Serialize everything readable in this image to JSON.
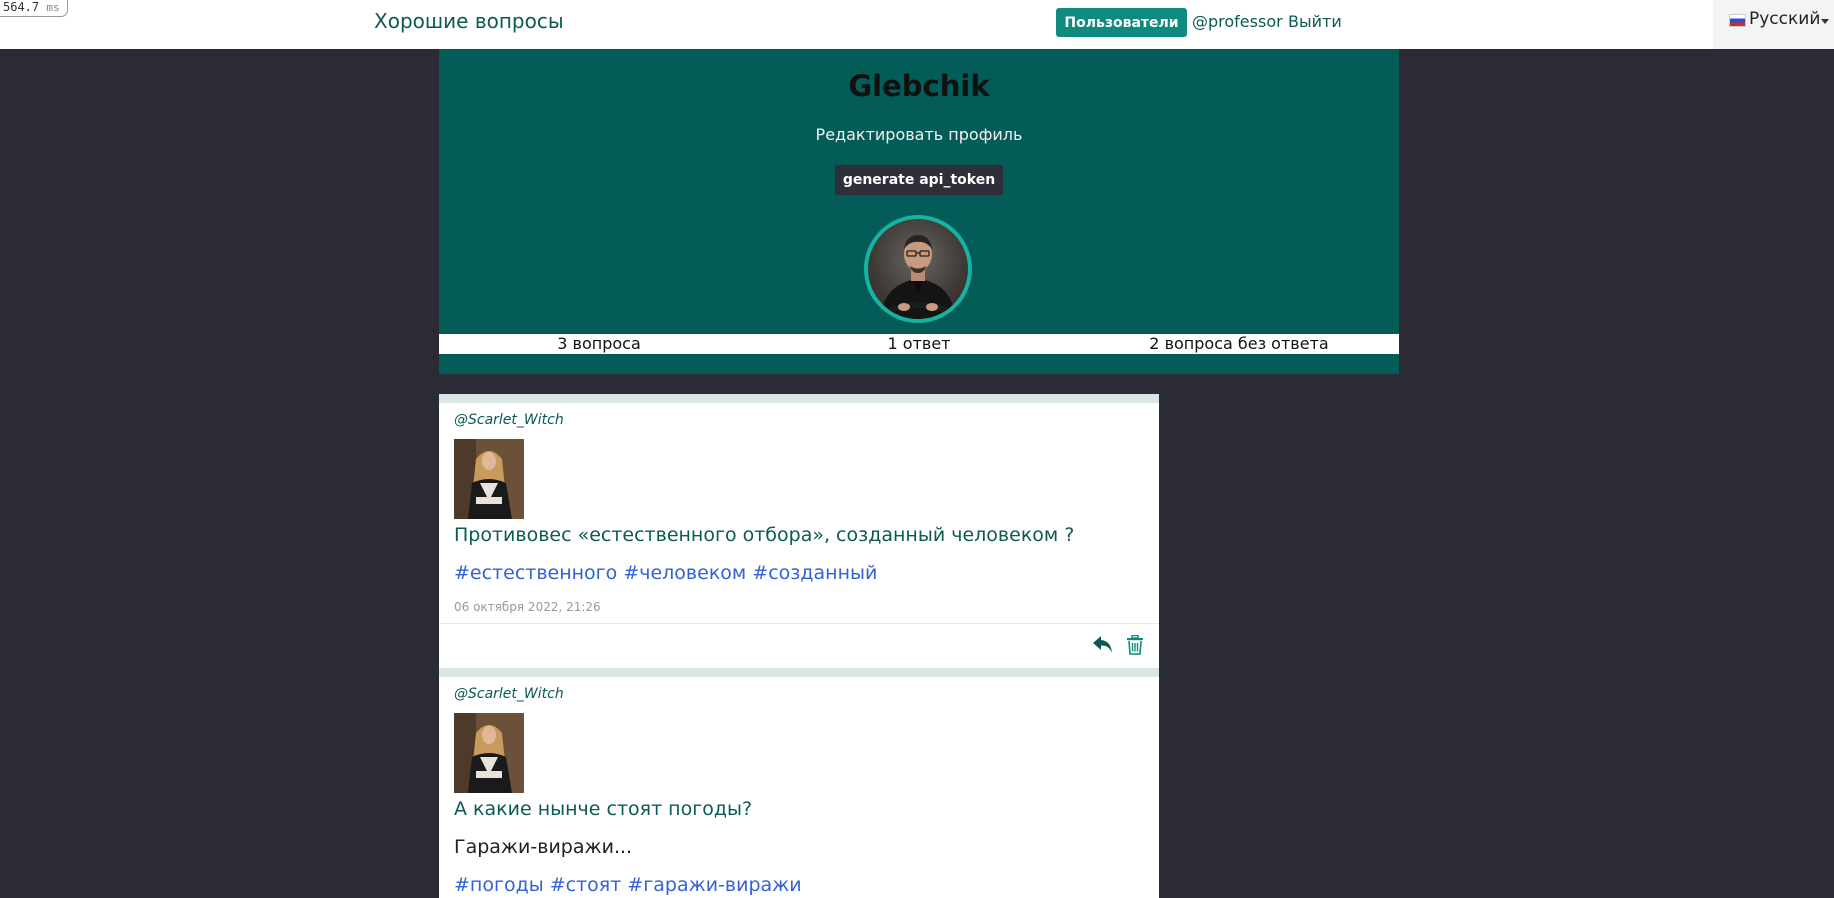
{
  "timer": {
    "value": "564.7",
    "unit": "ms"
  },
  "nav": {
    "brand": "Хорошие вопросы",
    "users_button": "Пользователи",
    "username": "@professor",
    "logout": "Выйти",
    "language": "Русский"
  },
  "profile": {
    "name": "Glebchik",
    "edit_label": "Редактировать профиль",
    "token_button": "generate api_token"
  },
  "stats": {
    "questions": "3 вопроса",
    "answers": "1 ответ",
    "unanswered": "2 вопроса без ответа"
  },
  "questions": [
    {
      "author": "@Scarlet_Witch",
      "title": "Противовес «естественного отбора», созданный человеком ?",
      "tags": "#естественного #человеком #созданный",
      "date": "06 октября 2022, 21:26"
    },
    {
      "author": "@Scarlet_Witch",
      "title": "А какие нынче стоят погоды?",
      "body": "Гаражи-виражи...",
      "tags": "#погоды #стоят #гаражи-виражи"
    }
  ],
  "colors": {
    "accent": "#0e8a7f",
    "header_bg": "#035c57",
    "page_bg": "#2b2b36",
    "tag": "#3361d8"
  }
}
